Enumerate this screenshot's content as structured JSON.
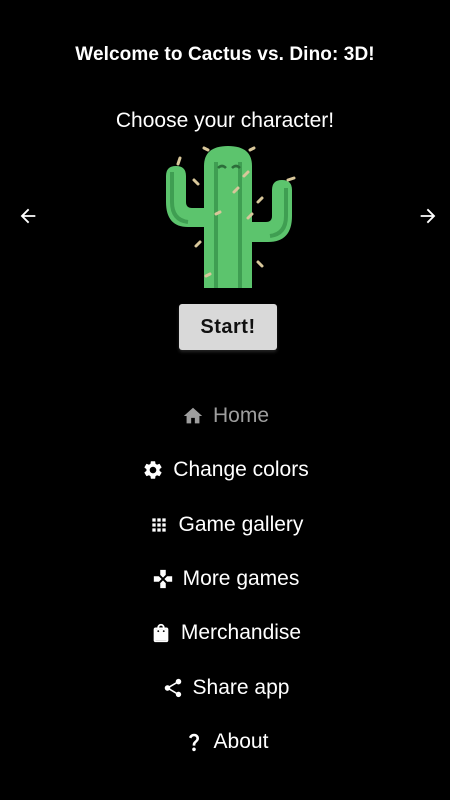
{
  "header": {
    "title": "Welcome to Cactus vs. Dino: 3D!",
    "subtitle": "Choose your character!"
  },
  "character_picker": {
    "prev_icon": "arrow-left-icon",
    "next_icon": "arrow-right-icon",
    "selected_character_icon": "cactus-icon"
  },
  "start_button": {
    "label": "Start!"
  },
  "menu": {
    "items": [
      {
        "label": "Home",
        "icon": "home-icon",
        "active": true
      },
      {
        "label": "Change colors",
        "icon": "gear-icon"
      },
      {
        "label": "Game gallery",
        "icon": "grid-icon"
      },
      {
        "label": "More games",
        "icon": "gamepad-icon"
      },
      {
        "label": "Merchandise",
        "icon": "shopping-bag-icon"
      },
      {
        "label": "Share app",
        "icon": "share-icon"
      },
      {
        "label": "About",
        "icon": "question-icon"
      }
    ]
  },
  "colors": {
    "background": "#000000",
    "text": "#ffffff",
    "active_menu_text": "#9e9e9e",
    "button_bg": "#d9d9d9",
    "cactus_green": "#5cc46d"
  }
}
